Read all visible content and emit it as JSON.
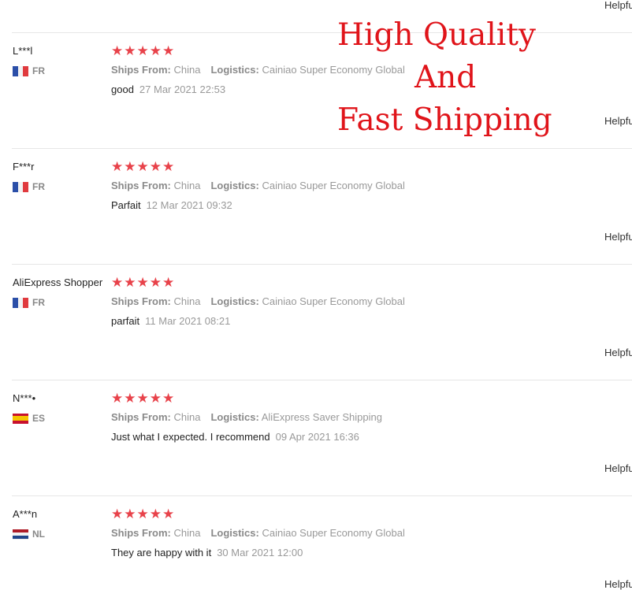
{
  "helpful_label": "Helpful",
  "labels": {
    "ships_from": "Ships From:",
    "logistics": "Logistics:"
  },
  "stars": "★★★★★",
  "colors": {
    "star": "#e8424a",
    "banner": "#e0141a"
  },
  "banner": {
    "line1": "High Quality",
    "line2": "And",
    "line3": "Fast Shipping"
  },
  "reviews": [
    {
      "user": "L***l",
      "country": "FR",
      "flag": "france-flag-icon",
      "ships_from": "China",
      "logistics": "Cainiao Super Economy Global",
      "comment": "good",
      "date": "27 Mar 2021 22:53",
      "rating": 5
    },
    {
      "user": "F***r",
      "country": "FR",
      "flag": "france-flag-icon",
      "ships_from": "China",
      "logistics": "Cainiao Super Economy Global",
      "comment": "Parfait",
      "date": "12 Mar 2021 09:32",
      "rating": 5
    },
    {
      "user": "AliExpress Shopper",
      "country": "FR",
      "flag": "france-flag-icon",
      "ships_from": "China",
      "logistics": "Cainiao Super Economy Global",
      "comment": "parfait",
      "date": "11 Mar 2021 08:21",
      "rating": 5
    },
    {
      "user": "N***•",
      "country": "ES",
      "flag": "spain-flag-icon",
      "ships_from": "China",
      "logistics": "AliExpress Saver Shipping",
      "comment": "Just what I expected. I recommend",
      "date": "09 Apr 2021 16:36",
      "rating": 5
    },
    {
      "user": "A***n",
      "country": "NL",
      "flag": "netherlands-flag-icon",
      "ships_from": "China",
      "logistics": "Cainiao Super Economy Global",
      "comment": "They are happy with it",
      "date": "30 Mar 2021 12:00",
      "rating": 5
    }
  ]
}
